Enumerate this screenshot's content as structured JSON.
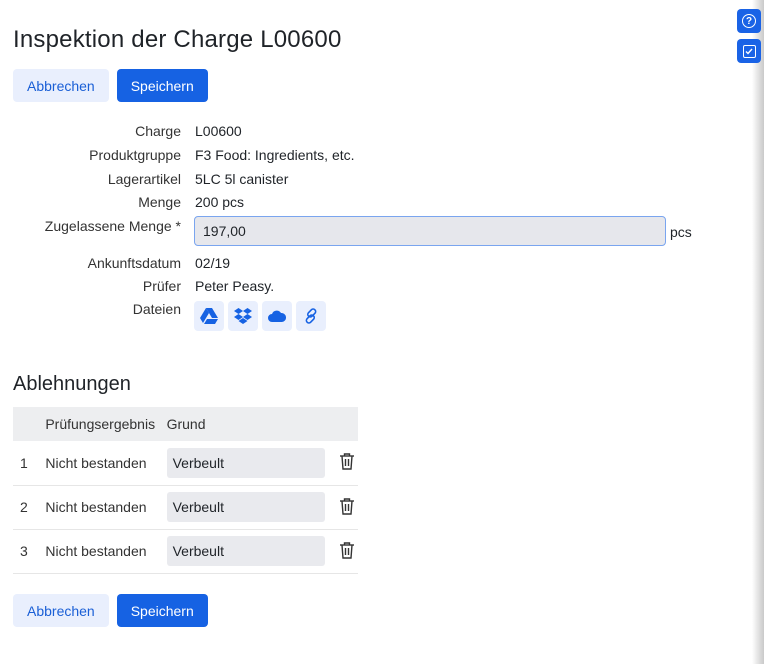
{
  "page": {
    "title": "Inspektion der Charge L00600"
  },
  "actions": {
    "cancel_label": "Abbrechen",
    "save_label": "Speichern"
  },
  "side_tools": {
    "help_icon": "help-circle-icon",
    "checklist_icon": "checkbox-icon"
  },
  "form": {
    "charge": {
      "label": "Charge",
      "value": "L00600"
    },
    "produktgruppe": {
      "label": "Produktgruppe",
      "value": "F3 Food: Ingredients, etc."
    },
    "lagerartikel": {
      "label": "Lagerartikel",
      "value": "5LC 5l canister"
    },
    "menge": {
      "label": "Menge",
      "value": "200 pcs"
    },
    "zugelassene_menge": {
      "label": "Zugelassene Menge *",
      "value": "197,00",
      "unit": "pcs"
    },
    "ankunftsdatum": {
      "label": "Ankunftsdatum",
      "value": "02/19"
    },
    "pruefer": {
      "label": "Prüfer",
      "value": "Peter Peasy."
    },
    "dateien": {
      "label": "Dateien",
      "icons": [
        "google-drive-icon",
        "dropbox-icon",
        "onedrive-cloud-icon",
        "link-icon"
      ]
    }
  },
  "rejections": {
    "title": "Ablehnungen",
    "columns": [
      "",
      "Prüfungsergebnis",
      "Grund"
    ],
    "rows": [
      {
        "index": "1",
        "result": "Nicht bestanden",
        "reason": "Verbeult"
      },
      {
        "index": "2",
        "result": "Nicht bestanden",
        "reason": "Verbeult"
      },
      {
        "index": "3",
        "result": "Nicht bestanden",
        "reason": "Verbeult"
      }
    ]
  },
  "colors": {
    "primary": "#1662e3",
    "secondary_bg": "#e9effd",
    "input_bg": "#e6e7ec"
  }
}
